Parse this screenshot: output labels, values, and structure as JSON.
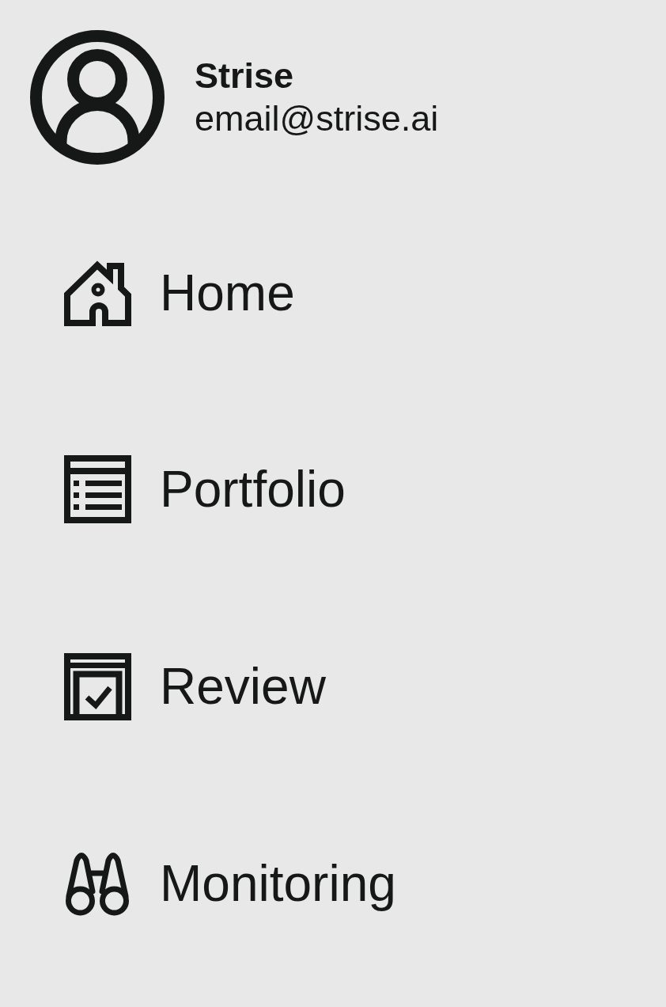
{
  "user": {
    "name": "Strise",
    "email": "email@strise.ai"
  },
  "nav": {
    "items": [
      {
        "label": "Home"
      },
      {
        "label": "Portfolio"
      },
      {
        "label": "Review"
      },
      {
        "label": "Monitoring"
      }
    ]
  }
}
